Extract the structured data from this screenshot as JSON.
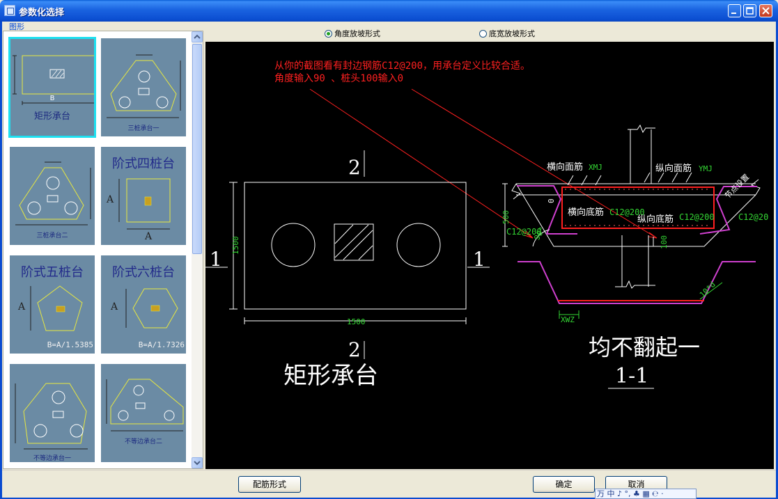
{
  "window": {
    "title": "参数化选择"
  },
  "group_label": "图形",
  "thumbnails": [
    {
      "caption": "矩形承台",
      "label": "B"
    },
    {
      "caption": "三桩承台一"
    },
    {
      "caption": "三桩承台二"
    },
    {
      "caption": "阶式四桩台",
      "label": "A"
    },
    {
      "caption": "阶式五桩台",
      "formula": "B=A/1.5385",
      "label": "A"
    },
    {
      "caption": "阶式六桩台",
      "formula": "B=A/1.7326",
      "label": "A"
    },
    {
      "caption": "不等边承台一"
    },
    {
      "caption": "不等边承台二"
    }
  ],
  "radio": {
    "angle": {
      "label": "角度放坡形式",
      "checked": true
    },
    "width": {
      "label": "底宽放坡形式",
      "checked": false
    }
  },
  "drawing": {
    "note_line1": "从你的截图看有封边钢筋C12@200，用承台定义比较合适。",
    "note_line2": "角度输入90 、桩头100输入0",
    "plan": {
      "section_top": "2",
      "section_bottom": "2",
      "section_left": "1",
      "section_right": "1",
      "dim_height": "1500",
      "dim_width": "1500",
      "title": "矩形承台"
    },
    "section": {
      "label_xmj_cn": "横向面筋",
      "label_xmj": "XMJ",
      "label_ymj_cn": "纵向面筋",
      "label_ymj": "YMJ",
      "label_top_bottom_cn": "横向底筋",
      "label_top_bottom_val": "C12@200",
      "label_long_bottom_cn": "纵向底筋",
      "label_long_bottom_val": "C12@200",
      "label_right": "C12@20",
      "label_left": "C12@200",
      "label_cut": "节点设置",
      "dim_500": "500",
      "dim_0": "0",
      "dim_100": "100",
      "angle": "90°",
      "xwz": "XWZ",
      "ld": "10*d",
      "caption": "均不翻起一",
      "section_id": "1-1"
    }
  },
  "buttons": {
    "rebar_form": "配筋形式",
    "ok": "确定",
    "cancel": "取消"
  },
  "ime": {
    "text": "万 中 ♪ °, ♣ ▦ ℮ ·"
  }
}
